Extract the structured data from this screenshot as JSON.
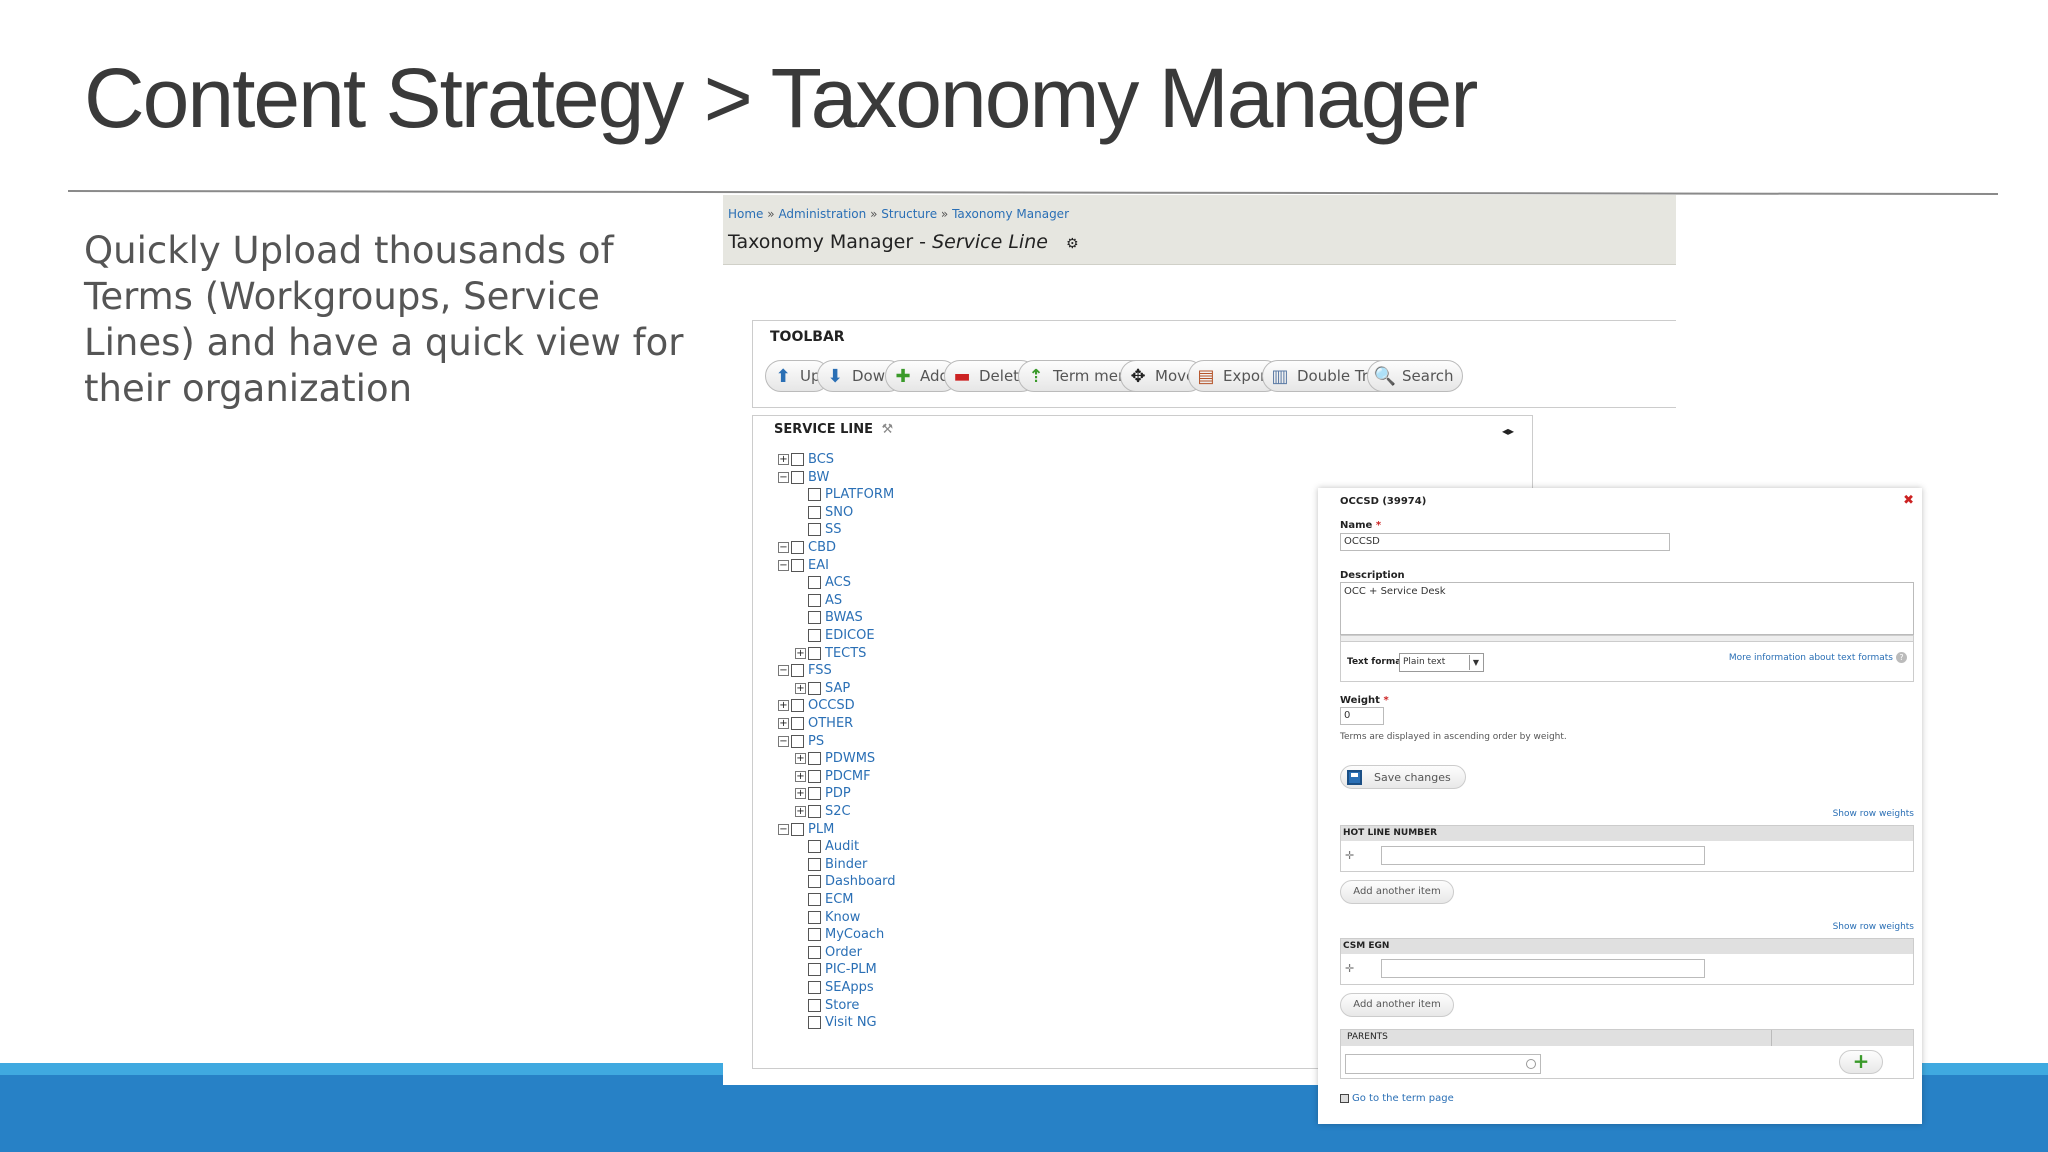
{
  "slide": {
    "title": "Content Strategy > Taxonomy Manager",
    "bullet": "Quickly Upload thousands of Terms (Workgroups, Service Lines) and have a quick view for their organization"
  },
  "header": {
    "breadcrumb": [
      "Home",
      "Administration",
      "Structure",
      "Taxonomy Manager"
    ],
    "breadcrumb_sep": "»",
    "title_prefix": "Taxonomy Manager - ",
    "title_vocab": "Service Line",
    "gear_icon": "gear-icon"
  },
  "toolbar": {
    "title": "TOOLBAR",
    "buttons": [
      {
        "label": "Up",
        "icon": "arrow-up-icon",
        "glyph": "⬆",
        "color": "#2a6fb5"
      },
      {
        "label": "Down",
        "icon": "arrow-down-icon",
        "glyph": "⬇",
        "color": "#2a6fb5"
      },
      {
        "label": "Add",
        "icon": "plus-icon",
        "glyph": "✚",
        "color": "#3a9a2a"
      },
      {
        "label": "Delete",
        "icon": "minus-icon",
        "glyph": "▬",
        "color": "#cc2222"
      },
      {
        "label": "Term merge",
        "icon": "merge-icon",
        "glyph": "⇡",
        "color": "#3a9a2a"
      },
      {
        "label": "Move",
        "icon": "move-icon",
        "glyph": "✥",
        "color": "#222222"
      },
      {
        "label": "Export",
        "icon": "export-icon",
        "glyph": "▤",
        "color": "#b5542a"
      },
      {
        "label": "Double Tree",
        "icon": "double-tree-icon",
        "glyph": "▥",
        "color": "#5a7aa5"
      },
      {
        "label": "Search",
        "icon": "search-icon",
        "glyph": "🔍",
        "color": "#777777"
      }
    ]
  },
  "tree": {
    "title": "SERVICE LINE",
    "nodes": [
      {
        "label": "BCS",
        "depth": 0,
        "expander": "+"
      },
      {
        "label": "BW",
        "depth": 0,
        "expander": "-"
      },
      {
        "label": "PLATFORM",
        "depth": 1,
        "expander": ""
      },
      {
        "label": "SNO",
        "depth": 1,
        "expander": ""
      },
      {
        "label": "SS",
        "depth": 1,
        "expander": ""
      },
      {
        "label": "CBD",
        "depth": 0,
        "expander": "-"
      },
      {
        "label": "EAI",
        "depth": 0,
        "expander": "-"
      },
      {
        "label": "ACS",
        "depth": 1,
        "expander": ""
      },
      {
        "label": "AS",
        "depth": 1,
        "expander": ""
      },
      {
        "label": "BWAS",
        "depth": 1,
        "expander": ""
      },
      {
        "label": "EDICOE",
        "depth": 1,
        "expander": ""
      },
      {
        "label": "TECTS",
        "depth": 1,
        "expander": "+"
      },
      {
        "label": "FSS",
        "depth": 0,
        "expander": "-"
      },
      {
        "label": "SAP",
        "depth": 1,
        "expander": "+"
      },
      {
        "label": "OCCSD",
        "depth": 0,
        "expander": "+"
      },
      {
        "label": "OTHER",
        "depth": 0,
        "expander": "+"
      },
      {
        "label": "PS",
        "depth": 0,
        "expander": "-"
      },
      {
        "label": "PDWMS",
        "depth": 1,
        "expander": "+"
      },
      {
        "label": "PDCMF",
        "depth": 1,
        "expander": "+"
      },
      {
        "label": "PDP",
        "depth": 1,
        "expander": "+"
      },
      {
        "label": "S2C",
        "depth": 1,
        "expander": "+"
      },
      {
        "label": "PLM",
        "depth": 0,
        "expander": "-"
      },
      {
        "label": "Audit",
        "depth": 1,
        "expander": ""
      },
      {
        "label": "Binder",
        "depth": 1,
        "expander": ""
      },
      {
        "label": "Dashboard",
        "depth": 1,
        "expander": ""
      },
      {
        "label": "ECM",
        "depth": 1,
        "expander": ""
      },
      {
        "label": "Know",
        "depth": 1,
        "expander": ""
      },
      {
        "label": "MyCoach",
        "depth": 1,
        "expander": ""
      },
      {
        "label": "Order",
        "depth": 1,
        "expander": ""
      },
      {
        "label": "PIC-PLM",
        "depth": 1,
        "expander": ""
      },
      {
        "label": "SEApps",
        "depth": 1,
        "expander": ""
      },
      {
        "label": "Store",
        "depth": 1,
        "expander": ""
      },
      {
        "label": "Visit NG",
        "depth": 1,
        "expander": ""
      }
    ]
  },
  "form": {
    "title": "OCCSD (39974)",
    "name_label": "Name",
    "name_value": "OCCSD",
    "description_label": "Description",
    "description_value": "OCC + Service Desk",
    "text_format_label": "Text format",
    "text_format_value": "Plain text",
    "text_format_link": "More information about text formats",
    "weight_label": "Weight",
    "weight_value": "0",
    "weight_hint": "Terms are displayed in ascending order by weight.",
    "save_label": "Save changes",
    "show_row_weights": "Show row weights",
    "hotline_title": "HOT LINE NUMBER",
    "csm_title": "CSM EGN",
    "add_another": "Add another item",
    "parents_title": "PARENTS",
    "goto_link": "Go to the term page",
    "required_mark": "*"
  }
}
